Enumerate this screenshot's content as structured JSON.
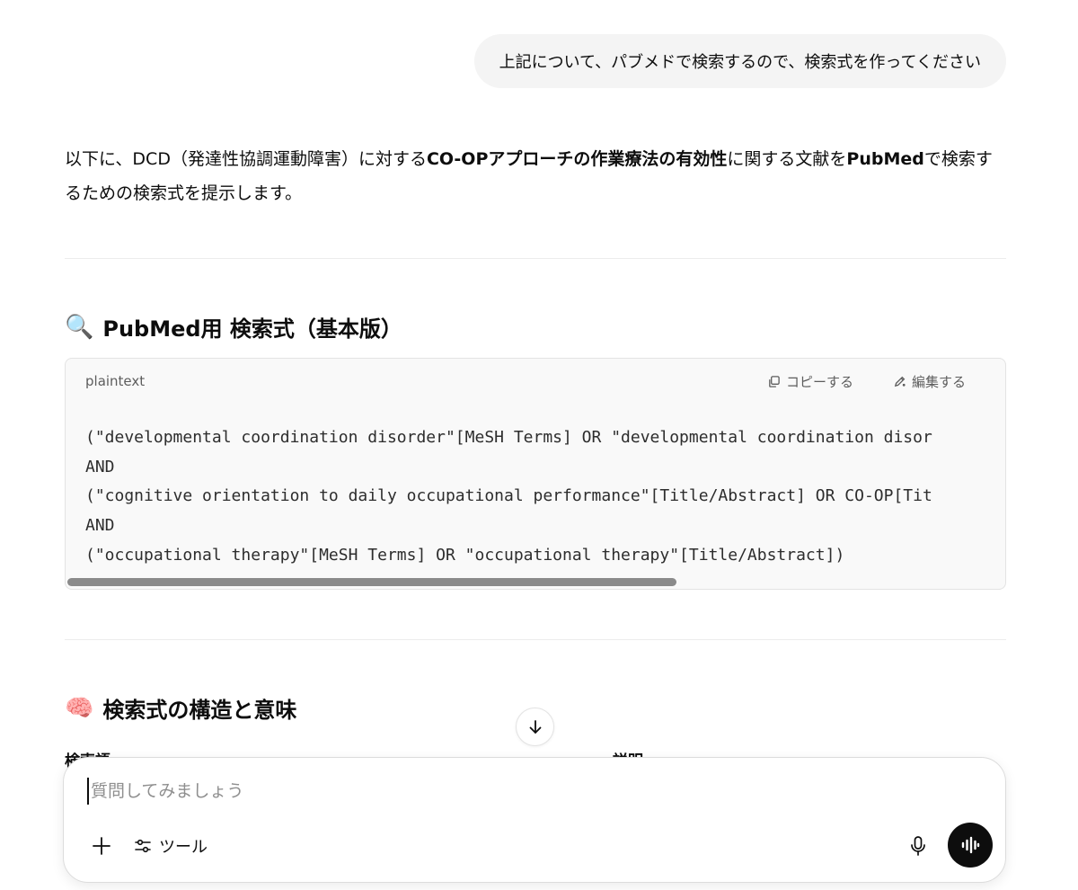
{
  "user_message": "上記について、パブメドで検索するので、検索式を作ってください",
  "assistant": {
    "intro_part1": "以下に、DCD（発達性協調運動障害）に対する",
    "intro_bold1": "CO-OPアプローチの作業療法の有効性",
    "intro_part2": "に関する文献を",
    "intro_bold2": "PubMed",
    "intro_part3": "で検索するための検索式を提示します。"
  },
  "section1": {
    "emoji": "🔍",
    "title": "PubMed用 検索式（基本版）"
  },
  "code_block": {
    "language": "plaintext",
    "copy_label": "コピーする",
    "edit_label": "編集する",
    "lines": [
      "(\"developmental coordination disorder\"[MeSH Terms] OR \"developmental coordination disor",
      "AND",
      "(\"cognitive orientation to daily occupational performance\"[Title/Abstract] OR CO-OP[Tit",
      "AND",
      "(\"occupational therapy\"[MeSH Terms] OR \"occupational therapy\"[Title/Abstract])"
    ]
  },
  "section2": {
    "emoji": "🧠",
    "title": "検索式の構造と意味"
  },
  "table": {
    "col1": "検索語",
    "col2": "説明"
  },
  "composer": {
    "placeholder": "質問してみましょう",
    "tools_label": "ツール"
  }
}
